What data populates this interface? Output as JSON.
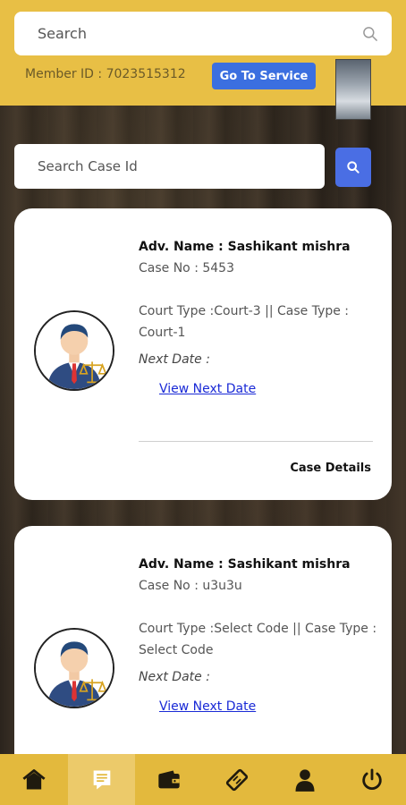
{
  "header": {
    "search_placeholder": "Search",
    "member_id": "Member ID : 7023515312",
    "service_button": "Go To Service"
  },
  "case_search": {
    "placeholder": "Search Case Id"
  },
  "cards": [
    {
      "adv_name": "Adv. Name : Sashikant mishra",
      "case_no": "Case No : 5453",
      "court_type": "Court Type :Court-3 || Case Type : Court-1",
      "next_date": "Next Date :",
      "view_link": "View Next Date",
      "details": "Case Details"
    },
    {
      "adv_name": "Adv. Name : Sashikant mishra",
      "case_no": "Case No : u3u3u",
      "court_type": "Court Type :Select Code || Case Type : Select Code",
      "next_date": "Next Date :",
      "view_link": "View Next Date"
    }
  ],
  "nav": {
    "items": [
      "home-icon",
      "cases-icon",
      "wallet-icon",
      "ticket-icon",
      "profile-icon",
      "power-icon"
    ],
    "active_index": 1
  },
  "colors": {
    "header": "#e8bf45",
    "accent_button": "#3b6fe0",
    "link": "#1a2ad6",
    "nav_bar": "#e3b93d"
  }
}
